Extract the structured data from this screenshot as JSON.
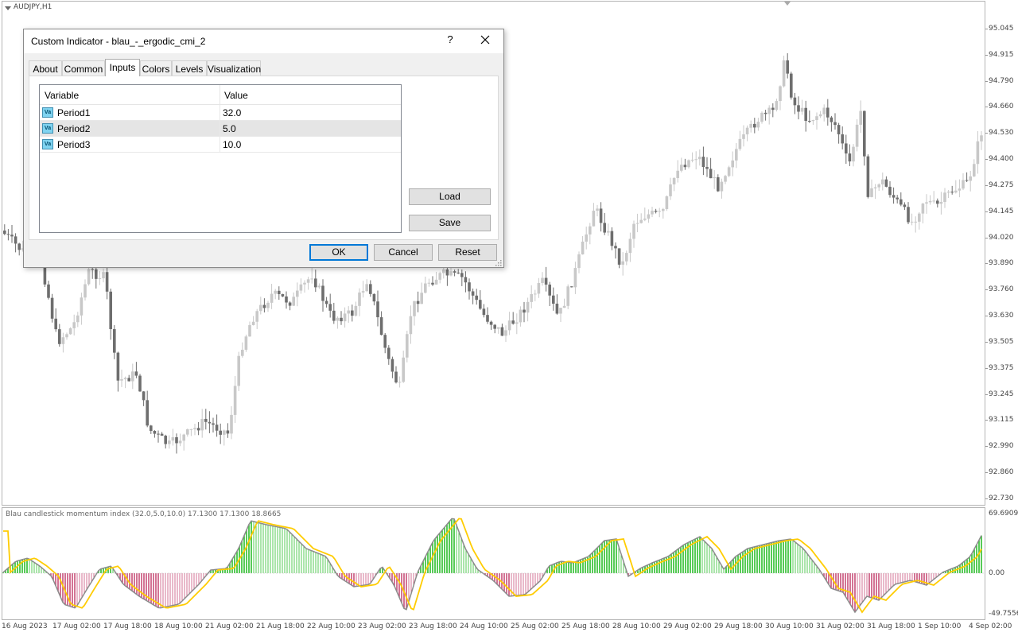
{
  "symbol": "AUDJPY,H1",
  "indicator_label": "Blau candlestick momentum index (32.0,5.0,10.0) 17.1300 17.1300 18.8665",
  "price_axis": [
    "95.045",
    "94.915",
    "94.790",
    "94.660",
    "94.530",
    "94.400",
    "94.275",
    "94.145",
    "94.020",
    "93.890",
    "93.760",
    "93.630",
    "93.505",
    "93.375",
    "93.245",
    "93.115",
    "92.990",
    "92.860",
    "92.730"
  ],
  "indicator_axis": {
    "max": "69.6909",
    "zero": "0.00",
    "min": "-49.7556"
  },
  "time_axis": [
    "16 Aug 2023",
    "17 Aug 02:00",
    "17 Aug 18:00",
    "18 Aug 10:00",
    "21 Aug 02:00",
    "21 Aug 18:00",
    "22 Aug 10:00",
    "23 Aug 02:00",
    "23 Aug 18:00",
    "24 Aug 10:00",
    "25 Aug 02:00",
    "25 Aug 18:00",
    "28 Aug 10:00",
    "29 Aug 02:00",
    "29 Aug 18:00",
    "30 Aug 10:00",
    "31 Aug 02:00",
    "31 Aug 18:00",
    "1 Sep 10:00",
    "4 Sep 02:00"
  ],
  "colors": {
    "bull": "#c8c8c8",
    "bear": "#6e6e6e",
    "hist_up": "#2dbe2d",
    "hist_down": "#c8507a",
    "signal": "#ffcc00",
    "line": "#8c8c8c",
    "accent": "#0078d7"
  },
  "chart_data": {
    "type": "candlestick",
    "indicator_name": "Blau candlestick momentum index",
    "y_range": [
      92.73,
      95.045
    ],
    "indicator_range": [
      -49.7556,
      69.6909
    ],
    "indicator_last": [
      17.13,
      17.13,
      18.8665
    ]
  },
  "dialog": {
    "title": "Custom Indicator - blau_-_ergodic_cmi_2",
    "help": "?",
    "tabs": [
      "About",
      "Common",
      "Inputs",
      "Colors",
      "Levels",
      "Visualization"
    ],
    "active_tab": "Inputs",
    "columns": {
      "variable": "Variable",
      "value": "Value"
    },
    "icon_text": "Va",
    "rows": [
      {
        "name": "Period1",
        "value": "32.0"
      },
      {
        "name": "Period2",
        "value": "5.0"
      },
      {
        "name": "Period3",
        "value": "10.0"
      }
    ],
    "selected_row": 1,
    "load": "Load",
    "save": "Save",
    "ok": "OK",
    "cancel": "Cancel",
    "reset": "Reset"
  }
}
